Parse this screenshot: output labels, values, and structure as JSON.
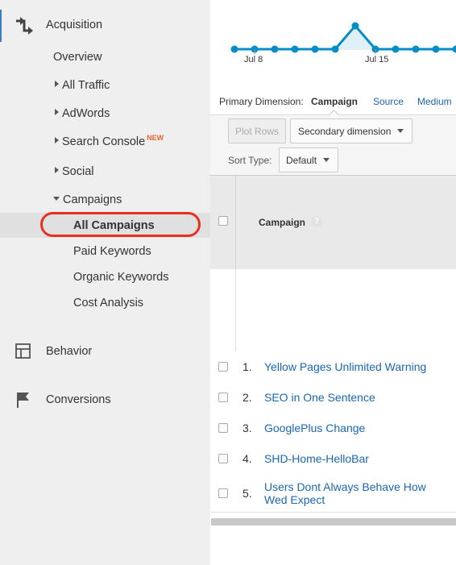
{
  "sidebar": {
    "acquisition": {
      "label": "Acquisition",
      "icon": "acquisition-arrows-icon"
    },
    "overview": "Overview",
    "all_traffic": "All Traffic",
    "adwords": "AdWords",
    "search_console": "Search Console",
    "search_console_badge": "NEW",
    "social": "Social",
    "campaigns": "Campaigns",
    "campaign_items": [
      {
        "label": "All Campaigns",
        "active": true
      },
      {
        "label": "Paid Keywords"
      },
      {
        "label": "Organic Keywords"
      },
      {
        "label": "Cost Analysis"
      }
    ],
    "behavior": {
      "label": "Behavior",
      "icon": "behavior-layout-icon"
    },
    "conversions": {
      "label": "Conversions",
      "icon": "flag-icon"
    }
  },
  "chart": {
    "x_labels": [
      "Jul 8",
      "Jul 15"
    ],
    "line_color": "#058dc7"
  },
  "chart_data": {
    "type": "line",
    "x_tick_labels": [
      "Jul 8",
      "Jul 15"
    ],
    "values": [
      0,
      0,
      0,
      0,
      0,
      0,
      1,
      0,
      0,
      0,
      0,
      0
    ]
  },
  "primary_dimension": {
    "label": "Primary Dimension:",
    "options": [
      "Campaign",
      "Source",
      "Medium"
    ],
    "selected": "Campaign"
  },
  "toolbar": {
    "plot_rows": "Plot Rows",
    "secondary_dimension": "Secondary dimension",
    "sort_type_label": "Sort Type:",
    "sort_type_value": "Default"
  },
  "table": {
    "column_header": "Campaign",
    "help": "?",
    "rows": [
      {
        "num": "1.",
        "name": "Yellow Pages Unlimited Warning"
      },
      {
        "num": "2.",
        "name": "SEO in One Sentence"
      },
      {
        "num": "3.",
        "name": "GooglePlus Change"
      },
      {
        "num": "4.",
        "name": "SHD-Home-HelloBar"
      },
      {
        "num": "5.",
        "name": "Users Dont Always Behave How Wed Expect"
      }
    ]
  },
  "colors": {
    "accent_link": "#1a67b4",
    "highlight": "#e8301f",
    "new_badge": "#e8652f"
  }
}
